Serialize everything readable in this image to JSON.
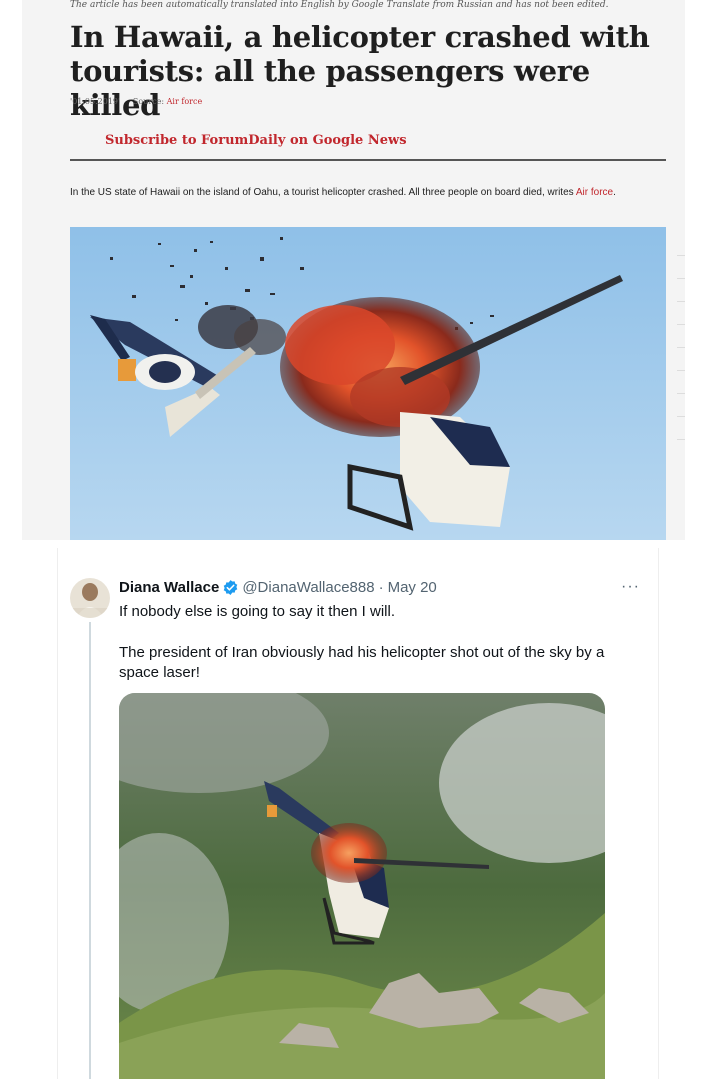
{
  "article": {
    "translation_notice": "The article has been automatically translated into English by Google Translate from Russian and has not been edited.",
    "headline": "In Hawaii, a helicopter crashed with tourists: all the passengers were killed",
    "date": "'01.05.2019'",
    "source_label": "Source:",
    "source_name": "Air force",
    "subscribe_link": "Subscribe to ForumDaily on Google News",
    "lead_text": "In the US state of Hawaii on the island of Oahu, a tourist helicopter crashed. All three people on board died, writes",
    "lead_source_link": "Air force",
    "lead_end": ".",
    "image_subject": "helicopter-exploding-midair"
  },
  "tweet": {
    "display_name": "Diana Wallace",
    "handle": "@DianaWallace888",
    "separator": "·",
    "date": "May 20",
    "more_label": "···",
    "text_line1": "If nobody else is going to say it then I will.",
    "text_line2": "The president of Iran obviously had his helicopter shot out of the sky by a space laser!",
    "media_subject": "helicopter-crashing-over-mountain",
    "verified_icon": "verified-badge-icon"
  },
  "colors": {
    "link_red": "#c1272d",
    "verified_blue": "#1d9bf0",
    "sky_blue": "#9cc8ea",
    "fire_orange": "#e2532a"
  }
}
